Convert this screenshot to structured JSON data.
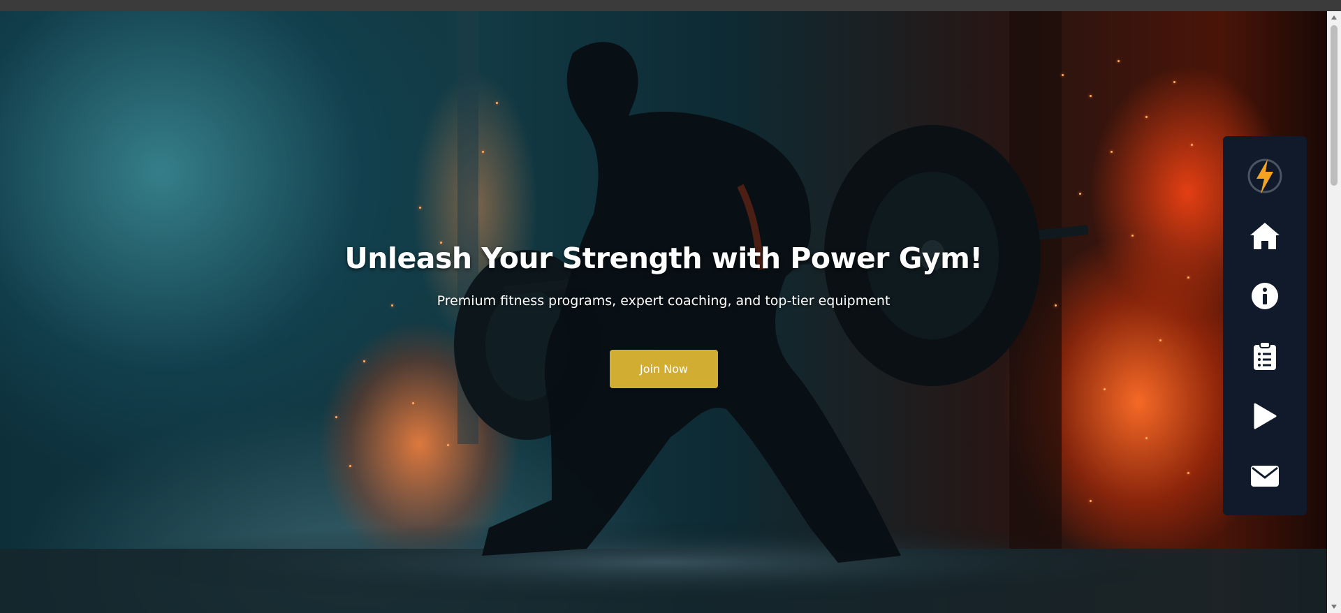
{
  "hero": {
    "title": "Unleash Your Strength with Power Gym!",
    "subtitle": "Premium fitness programs, expert coaching, and top-tier equipment",
    "cta_label": "Join Now",
    "cta_color": "#d1ad31"
  },
  "side_nav": {
    "background": "#101a2a",
    "items": [
      {
        "icon": "lightning-logo-icon"
      },
      {
        "icon": "home-icon"
      },
      {
        "icon": "info-icon"
      },
      {
        "icon": "clipboard-list-icon"
      },
      {
        "icon": "play-icon"
      },
      {
        "icon": "envelope-icon"
      }
    ]
  }
}
